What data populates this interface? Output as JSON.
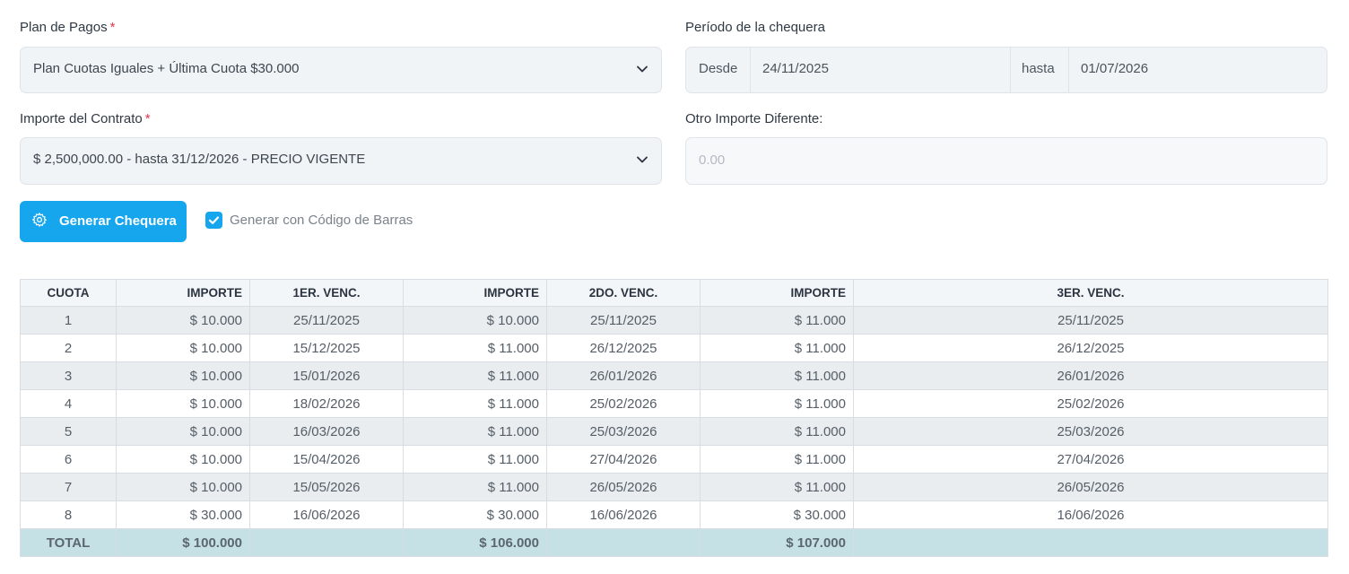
{
  "form": {
    "plan_label": "Plan de Pagos",
    "plan_value": "Plan Cuotas Iguales + Última Cuota $30.000",
    "period_label": "Período de la chequera",
    "desde_label": "Desde",
    "desde_value": "24/11/2025",
    "hasta_label": "hasta",
    "hasta_value": "01/07/2026",
    "importe_label": "Importe del Contrato",
    "importe_value": "$ 2,500,000.00 - hasta 31/12/2026 - PRECIO VIGENTE",
    "otro_label": "Otro Importe Diferente:",
    "otro_placeholder": "0.00",
    "required_mark": "*"
  },
  "actions": {
    "generate_label": "Generar Chequera",
    "barcode_label": "Generar con Código de Barras",
    "barcode_checked": true
  },
  "table": {
    "headers": [
      "CUOTA",
      "IMPORTE",
      "1ER. VENC.",
      "IMPORTE",
      "2DO. VENC.",
      "IMPORTE",
      "3ER. VENC."
    ],
    "rows": [
      [
        "1",
        "$ 10.000",
        "25/11/2025",
        "$ 10.000",
        "25/11/2025",
        "$ 11.000",
        "25/11/2025"
      ],
      [
        "2",
        "$ 10.000",
        "15/12/2025",
        "$ 11.000",
        "26/12/2025",
        "$ 11.000",
        "26/12/2025"
      ],
      [
        "3",
        "$ 10.000",
        "15/01/2026",
        "$ 11.000",
        "26/01/2026",
        "$ 11.000",
        "26/01/2026"
      ],
      [
        "4",
        "$ 10.000",
        "18/02/2026",
        "$ 11.000",
        "25/02/2026",
        "$ 11.000",
        "25/02/2026"
      ],
      [
        "5",
        "$ 10.000",
        "16/03/2026",
        "$ 11.000",
        "25/03/2026",
        "$ 11.000",
        "25/03/2026"
      ],
      [
        "6",
        "$ 10.000",
        "15/04/2026",
        "$ 11.000",
        "27/04/2026",
        "$ 11.000",
        "27/04/2026"
      ],
      [
        "7",
        "$ 10.000",
        "15/05/2026",
        "$ 11.000",
        "26/05/2026",
        "$ 11.000",
        "26/05/2026"
      ],
      [
        "8",
        "$ 30.000",
        "16/06/2026",
        "$ 30.000",
        "16/06/2026",
        "$ 30.000",
        "16/06/2026"
      ]
    ],
    "total": [
      "TOTAL",
      "$ 100.000",
      "",
      "$ 106.000",
      "",
      "$ 107.000",
      ""
    ]
  },
  "colors": {
    "accent": "#16a6ee",
    "total_row": "#c5e1e6",
    "striped_row": "#e9edf0",
    "required": "#e3344b"
  },
  "icons": [
    "chevron-down-icon",
    "gear-icon",
    "check-icon"
  ]
}
